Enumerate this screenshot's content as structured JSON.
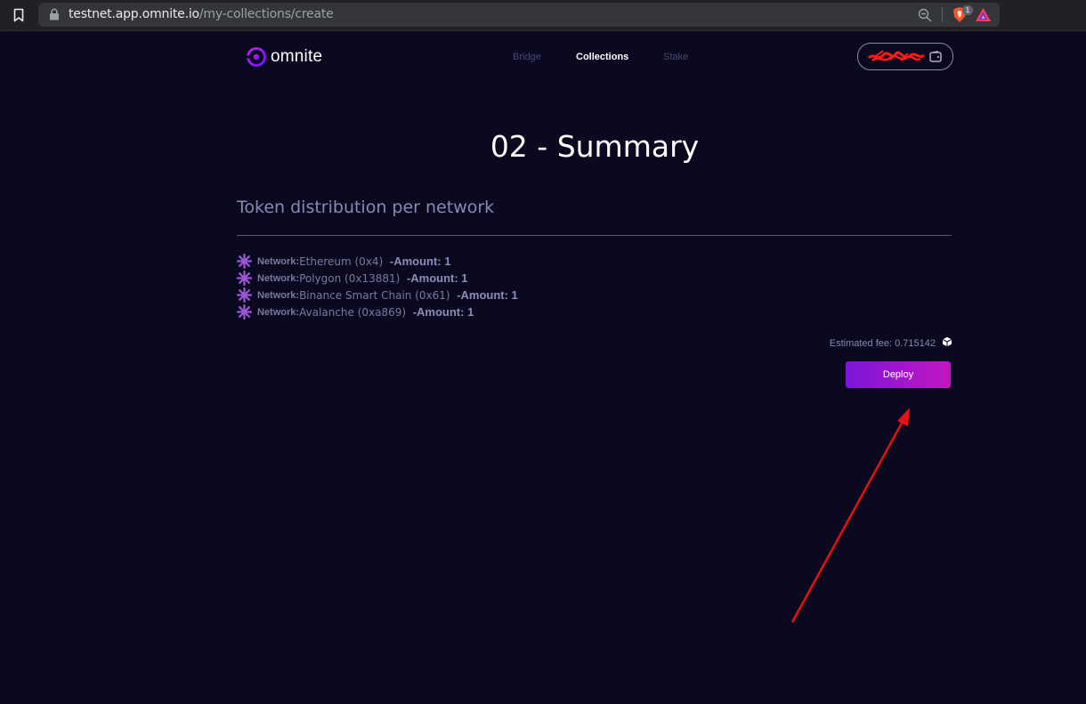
{
  "browser": {
    "url_host": "testnet.app.omnite.io",
    "url_path": "/my-collections/create",
    "brave_badge": "1"
  },
  "header": {
    "logo_text": "omnite",
    "nav": [
      {
        "label": "Bridge",
        "active": false
      },
      {
        "label": "Collections",
        "active": true
      },
      {
        "label": "Stake",
        "active": false
      }
    ],
    "wallet_address": "0x…scribbled"
  },
  "page": {
    "title": "02 - Summary",
    "section_title": "Token distribution per network",
    "networks": [
      {
        "label": "Network:",
        "name": "Ethereum (0x4)",
        "amount": "-Amount: 1"
      },
      {
        "label": "Network:",
        "name": "Polygon (0x13881)",
        "amount": "-Amount: 1"
      },
      {
        "label": "Network:",
        "name": "Binance Smart Chain (0x61)",
        "amount": "-Amount: 1"
      },
      {
        "label": "Network:",
        "name": "Avalanche (0xa869)",
        "amount": "-Amount: 1"
      }
    ],
    "fee_text": "Estimated fee: 0.715142",
    "deploy_label": "Deploy"
  },
  "colors": {
    "background": "#0a0920",
    "accent_start": "#7b16d8",
    "accent_end": "#c316c0",
    "annotation_arrow": "#e81010"
  }
}
